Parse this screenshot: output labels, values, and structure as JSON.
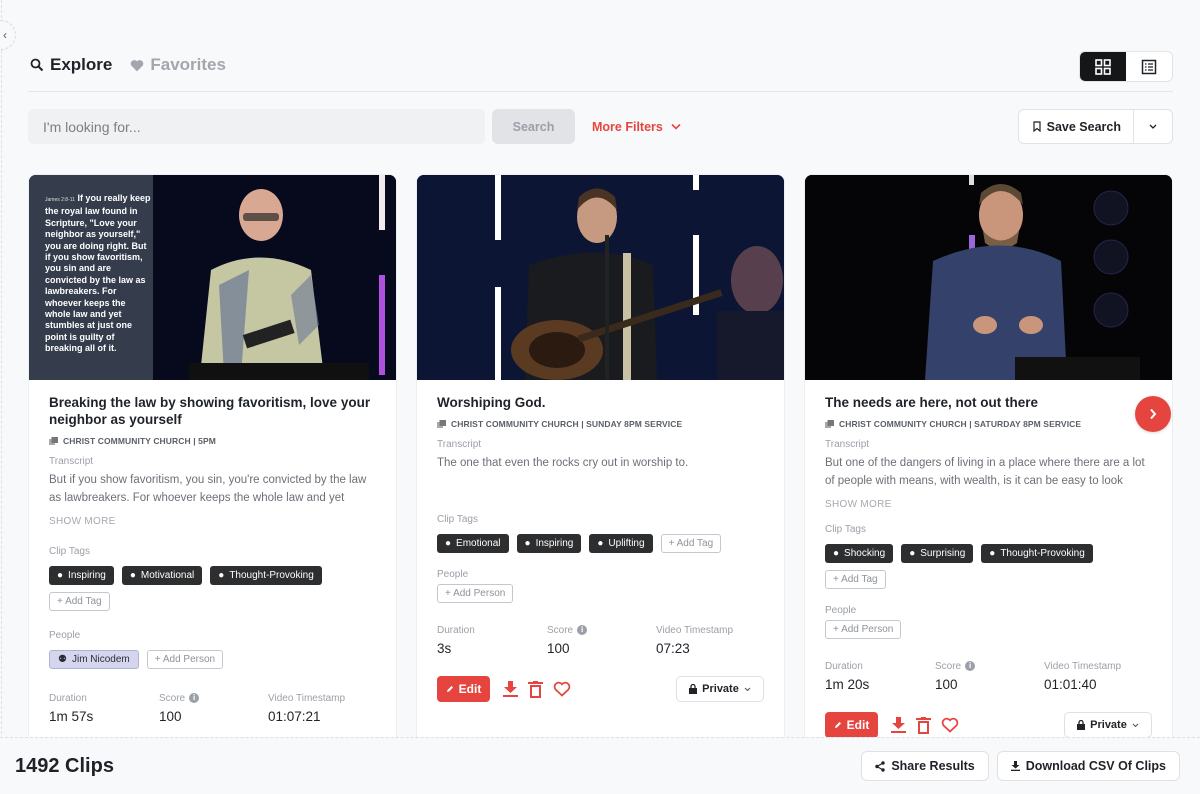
{
  "header": {
    "tabs": [
      {
        "label": "Explore",
        "icon": "search-icon",
        "active": true
      },
      {
        "label": "Favorites",
        "icon": "heart-icon",
        "active": false
      }
    ],
    "view_modes": [
      {
        "name": "grid",
        "icon": "grid-icon",
        "active": true
      },
      {
        "name": "list",
        "icon": "list-icon",
        "active": false
      }
    ]
  },
  "search": {
    "placeholder": "I'm looking for...",
    "value": "",
    "search_label": "Search",
    "more_filters_label": "More Filters",
    "save_search_label": "Save Search"
  },
  "colors": {
    "accent": "#e5453e",
    "tag_bg": "#2d2e30",
    "person_bg": "#d5d6ee",
    "active_toggle": "#151617"
  },
  "labels": {
    "transcript": "Transcript",
    "show_more": "SHOW MORE",
    "clip_tags": "Clip Tags",
    "people": "People",
    "add_tag": "+ Add Tag",
    "add_person": "+ Add Person",
    "duration": "Duration",
    "score": "Score",
    "video_timestamp": "Video Timestamp",
    "edit": "Edit",
    "privacy": "Private"
  },
  "clips": [
    {
      "title": "Breaking the law by showing favoritism, love your neighbor as yourself",
      "source": "CHRIST COMMUNITY CHURCH | 5PM",
      "transcript": "But if you show favoritism, you sin, you're convicted by the law as lawbreakers. For whoever keeps the whole law and yet",
      "has_show_more": true,
      "tags": [
        "Inspiring",
        "Motivational",
        "Thought-Provoking"
      ],
      "people": [
        "Jim Nicodem"
      ],
      "duration": "1m 57s",
      "score": "100",
      "video_timestamp": "01:07:21",
      "overlay": {
        "ref": "James 2:8-11",
        "text": "If you really keep the royal law found in Scripture, \"Love your neighbor as yourself,\" you are doing right. But if you show favoritism, you sin and are convicted by the law as lawbreakers. For whoever keeps the whole law and yet stumbles at just one point is guilty of breaking all of it."
      }
    },
    {
      "title": "Worshiping God.",
      "source": "CHRIST COMMUNITY CHURCH | SUNDAY 8PM SERVICE",
      "transcript": "The one that even the rocks cry out in worship to.",
      "has_show_more": false,
      "tags": [
        "Emotional",
        "Inspiring",
        "Uplifting"
      ],
      "people": [],
      "duration": "3s",
      "score": "100",
      "video_timestamp": "07:23"
    },
    {
      "title": "The needs are here, not out there",
      "source": "CHRIST COMMUNITY CHURCH | SATURDAY 8PM SERVICE",
      "transcript": "But one of the dangers of living in a place where there are a lot of people with means, with wealth, is it can be easy to look",
      "has_show_more": true,
      "tags": [
        "Shocking",
        "Surprising",
        "Thought-Provoking"
      ],
      "people": [],
      "duration": "1m 20s",
      "score": "100",
      "video_timestamp": "01:01:40"
    }
  ],
  "footer": {
    "clip_count": "1492 Clips",
    "share_label": "Share Results",
    "download_label": "Download CSV Of Clips"
  }
}
